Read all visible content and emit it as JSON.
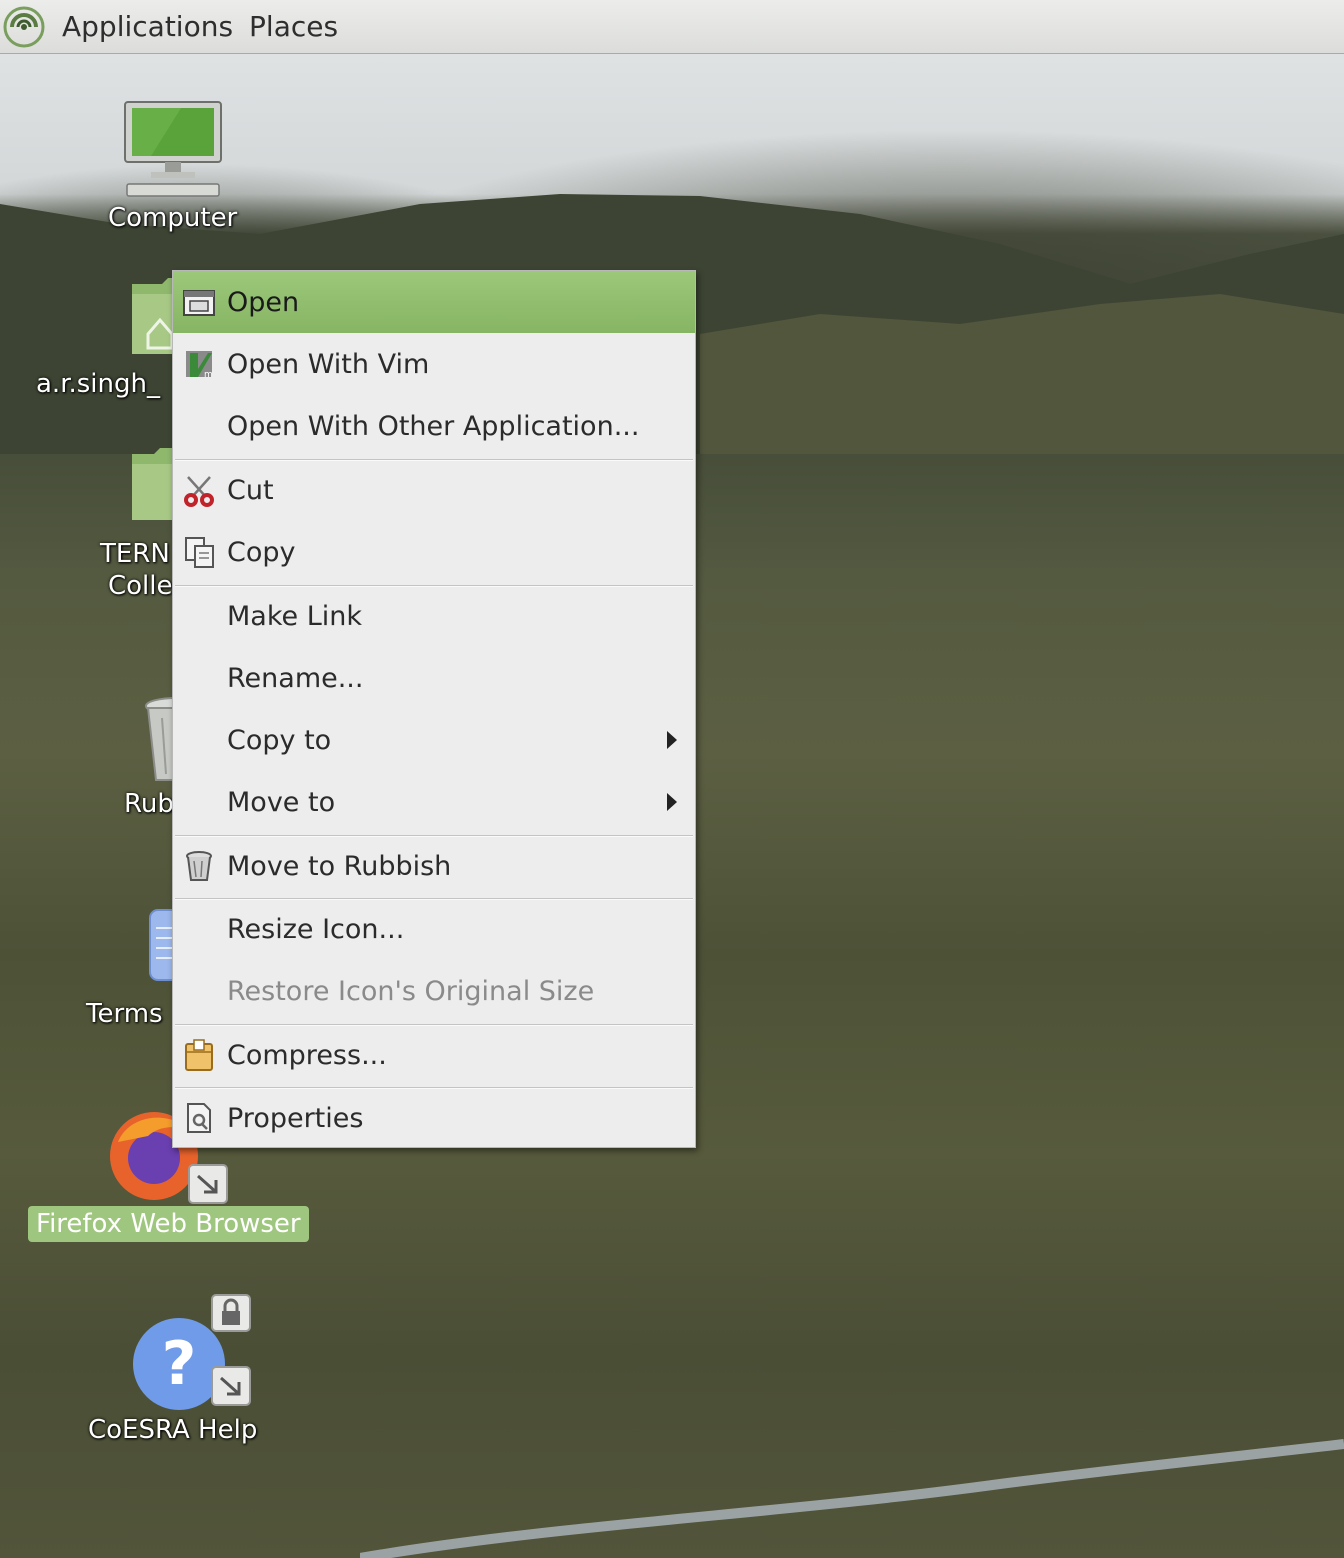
{
  "panel": {
    "menus": [
      "Applications",
      "Places"
    ]
  },
  "desktop": {
    "icons": [
      {
        "label": "Computer"
      },
      {
        "label": "a.r.singh_"
      },
      {
        "label_line1": "TERN",
        "label_line2": "Colle"
      },
      {
        "label": "Rub"
      },
      {
        "label": "Terms"
      },
      {
        "label": "Firefox Web Browser"
      },
      {
        "label": "CoESRA Help"
      }
    ]
  },
  "context_menu": {
    "items": [
      {
        "label": "Open",
        "icon": "open-folder-icon",
        "state": "highlighted"
      },
      {
        "label": "Open With Vim",
        "icon": "vim-icon"
      },
      {
        "label": "Open With Other Application...",
        "icon": ""
      },
      {
        "label": "Cut",
        "icon": "scissors-icon"
      },
      {
        "label": "Copy",
        "icon": "copy-icon"
      },
      {
        "label": "Make Link",
        "icon": ""
      },
      {
        "label": "Rename...",
        "icon": ""
      },
      {
        "label": "Copy to",
        "icon": "",
        "submenu": true
      },
      {
        "label": "Move to",
        "icon": "",
        "submenu": true
      },
      {
        "label": "Move to Rubbish",
        "icon": "trash-icon"
      },
      {
        "label": "Resize Icon...",
        "icon": ""
      },
      {
        "label": "Restore Icon's Original Size",
        "icon": "",
        "state": "disabled"
      },
      {
        "label": "Compress...",
        "icon": "archive-icon"
      },
      {
        "label": "Properties",
        "icon": "properties-icon"
      }
    ]
  },
  "colors": {
    "accent": "#9fc67e",
    "menu_bg": "#ededed",
    "panel_bg": "#e4e5e3"
  }
}
